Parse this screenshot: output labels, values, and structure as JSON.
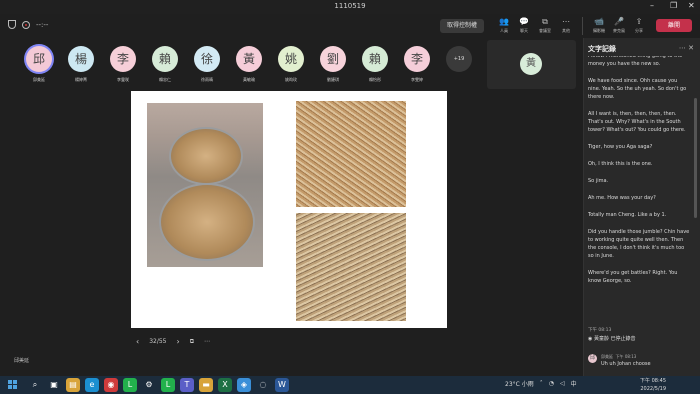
{
  "window": {
    "title": "1110519",
    "controls": [
      "–",
      "❐",
      "✕"
    ]
  },
  "toolbar": {
    "time": "--:--",
    "stop_control": "取得控制權",
    "items": [
      {
        "icon": "people-icon",
        "glyph": "👥",
        "label": "人員"
      },
      {
        "icon": "chat-icon",
        "glyph": "💬",
        "label": "聊天"
      },
      {
        "icon": "rooms-icon",
        "glyph": "⧉",
        "label": "會議室"
      },
      {
        "icon": "more-icon",
        "glyph": "⋯",
        "label": "其他"
      }
    ],
    "device_items": [
      {
        "icon": "camera-icon",
        "glyph": "📹",
        "label": "攝影機"
      },
      {
        "icon": "mic-icon",
        "glyph": "🎤",
        "label": "麥克風"
      },
      {
        "icon": "share-icon",
        "glyph": "⇪",
        "label": "分享"
      }
    ],
    "leave": "離開"
  },
  "participants": [
    {
      "char": "邱",
      "name": "邱美延",
      "color": "#f3c9d6",
      "active": true
    },
    {
      "char": "楊",
      "name": "楊婷菁",
      "color": "#cde8f2"
    },
    {
      "char": "李",
      "name": "李靈咲",
      "color": "#f6cfd8"
    },
    {
      "char": "賴",
      "name": "賴忠仁",
      "color": "#d7ecd8"
    },
    {
      "char": "徐",
      "name": "徐雨晴",
      "color": "#d3eaf4"
    },
    {
      "char": "黃",
      "name": "黃敏瑜",
      "color": "#f5cdd8"
    },
    {
      "char": "姚",
      "name": "姚昀玫",
      "color": "#e2efcf"
    },
    {
      "char": "劉",
      "name": "劉婕琪",
      "color": "#f7d3db"
    },
    {
      "char": "賴",
      "name": "賴怡彤",
      "color": "#d6ecd6"
    },
    {
      "char": "李",
      "name": "李雯婷",
      "color": "#f5ced9"
    }
  ],
  "more_participants": "+19",
  "self_tile": {
    "char": "黃"
  },
  "pager": {
    "page": "32/55"
  },
  "presenter_name": "邱美延",
  "transcript_panel": {
    "title": "文字記錄",
    "lines": [
      "I know i mentioned thing going to the money you have the new so.",
      "We have food since. Ohh cause you nine. Yeah. So the uh yeah. So don't go there now.",
      "All I want is, then, then, then, then. That's out. Why? What's in the South tower? What's out? You could go there.",
      "Tiger, how you Aga saga?",
      "Oh, I think this is the one.",
      "So jima.",
      "Ah me. How was your day?",
      "Totally man Cheng. Like a by 1.",
      "Did you handle those jumble? Chin have to working quite quite well then. Then the console, I don't think it's much too so in June.",
      "Where'd you get battles? Right. You know George, so."
    ],
    "system": {
      "time": "下午 08:13",
      "text": "黃童齡 已停止錄音"
    },
    "chat": {
      "avatar": "邱",
      "name": "邱美延",
      "time": "下午 08:13",
      "text": "Uh uh Johan choose"
    }
  },
  "taskbar": {
    "apps": [
      {
        "icon": "search-icon",
        "glyph": "⌕",
        "color": "transparent"
      },
      {
        "icon": "task-view-icon",
        "glyph": "▣",
        "color": "transparent"
      },
      {
        "icon": "explorer-icon",
        "glyph": "▤",
        "color": "#d8a43a"
      },
      {
        "icon": "edge-icon",
        "glyph": "e",
        "color": "#1b8fd1"
      },
      {
        "icon": "chrome-icon",
        "glyph": "◉",
        "color": "#cf3b3b"
      },
      {
        "icon": "line-icon",
        "glyph": "L",
        "color": "#22b14c"
      },
      {
        "icon": "settings-icon",
        "glyph": "⚙",
        "color": "transparent"
      },
      {
        "icon": "line-icon",
        "glyph": "L",
        "color": "#22b14c"
      },
      {
        "icon": "teams-icon",
        "glyph": "T",
        "color": "#5b5fc7"
      },
      {
        "icon": "folder-icon",
        "glyph": "▬",
        "color": "#d8a43a"
      },
      {
        "icon": "excel-icon",
        "glyph": "X",
        "color": "#1d7044"
      },
      {
        "icon": "photos-icon",
        "glyph": "◈",
        "color": "#3a8fd8"
      },
      {
        "icon": "sound-icon",
        "glyph": "◌",
        "color": "transparent"
      },
      {
        "icon": "word-icon",
        "glyph": "W",
        "color": "#2b5797"
      }
    ],
    "weather": "23°C 小雨",
    "time": "下午 08:45",
    "date": "2022/5/19"
  }
}
